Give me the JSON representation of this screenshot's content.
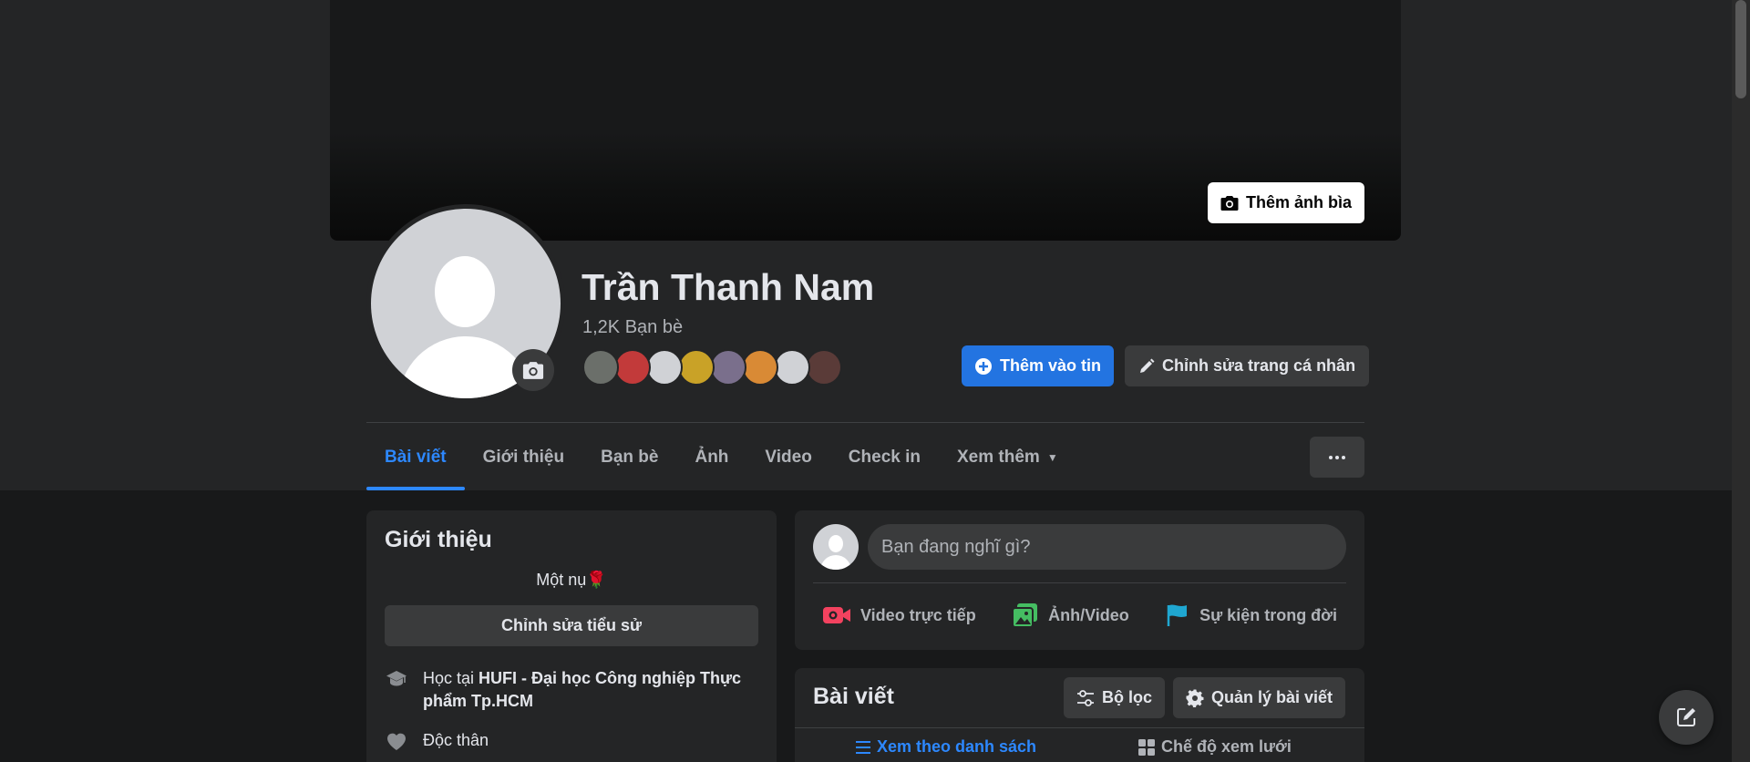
{
  "cover": {
    "add_cover_label": "Thêm ảnh bìa"
  },
  "profile": {
    "name": "Trần Thanh Nam",
    "friend_count": "1,2K Bạn bè",
    "friend_avatar_colors": [
      "#6b6f6a",
      "#c23a3a",
      "#d0d2d6",
      "#c9a227",
      "#7a6f8c",
      "#d98a35",
      "#d0d2d6",
      "#5a3b38"
    ]
  },
  "actions": {
    "add_story": "Thêm vào tin",
    "edit_profile": "Chỉnh sửa trang cá nhân"
  },
  "tabs": [
    {
      "label": "Bài viết",
      "active": true
    },
    {
      "label": "Giới thiệu"
    },
    {
      "label": "Bạn bè"
    },
    {
      "label": "Ảnh"
    },
    {
      "label": "Video"
    },
    {
      "label": "Check in"
    },
    {
      "label": "Xem thêm"
    }
  ],
  "intro": {
    "title": "Giới thiệu",
    "bio": "Một nụ🌹",
    "edit_bio": "Chỉnh sửa tiểu sử",
    "education_prefix": "Học tại ",
    "education_school": "HUFI - Đại học Công nghiệp Thực phẩm Tp.HCM",
    "relationship": "Độc thân"
  },
  "composer": {
    "placeholder": "Bạn đang nghĩ gì?",
    "live_video": "Video trực tiếp",
    "photo_video": "Ảnh/Video",
    "life_event": "Sự kiện trong đời"
  },
  "posts": {
    "title": "Bài viết",
    "filter": "Bộ lọc",
    "manage": "Quản lý bài viết",
    "list_view": "Xem theo danh sách",
    "grid_view": "Chế độ xem lưới"
  },
  "colors": {
    "accent": "#2d88ff",
    "primary_button": "#2374e1",
    "card": "#242526",
    "background": "#18191a"
  }
}
